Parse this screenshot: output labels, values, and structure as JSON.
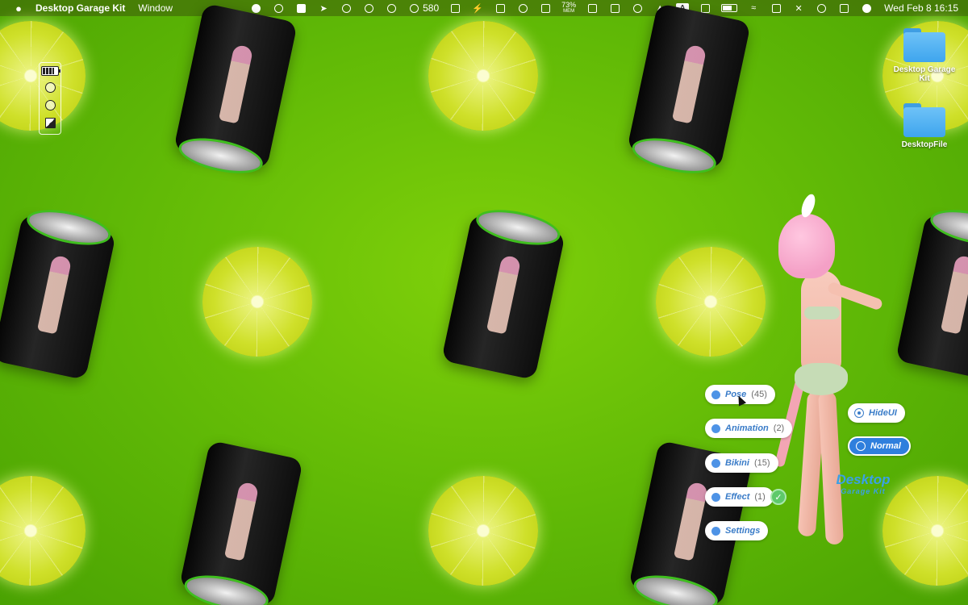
{
  "menubar": {
    "app_name": "Desktop Garage Kit",
    "menus": [
      "Window"
    ],
    "status_counter": "580",
    "memory_percent": "73%",
    "memory_label": "MEM",
    "input_source": "A",
    "clock": "Wed Feb 8  16:15"
  },
  "desktop": {
    "icons": [
      {
        "label": "Desktop Garage Kit",
        "icon": "folder-icon"
      },
      {
        "label": "DesktopFile",
        "icon": "folder-icon"
      }
    ]
  },
  "widget_toolbar": {
    "icons": [
      "battery-icon",
      "gear-icon",
      "aperture-icon",
      "contrast-icon"
    ]
  },
  "menu": {
    "pose": {
      "label": "Pose",
      "count": "(45)"
    },
    "animation": {
      "label": "Animation",
      "count": "(2)"
    },
    "bikini": {
      "label": "Bikini",
      "count": "(15)"
    },
    "effect": {
      "label": "Effect",
      "count": "(1)"
    },
    "settings": {
      "label": "Settings"
    },
    "hide_ui": {
      "label": "HideUI"
    },
    "normal": {
      "label": "Normal"
    }
  },
  "brand": {
    "line1": "Desktop",
    "line2": "Garage Kit"
  },
  "colors": {
    "wallpaper": "#5fb806",
    "accent": "#3a7cc8",
    "check": "#5ec96a"
  }
}
